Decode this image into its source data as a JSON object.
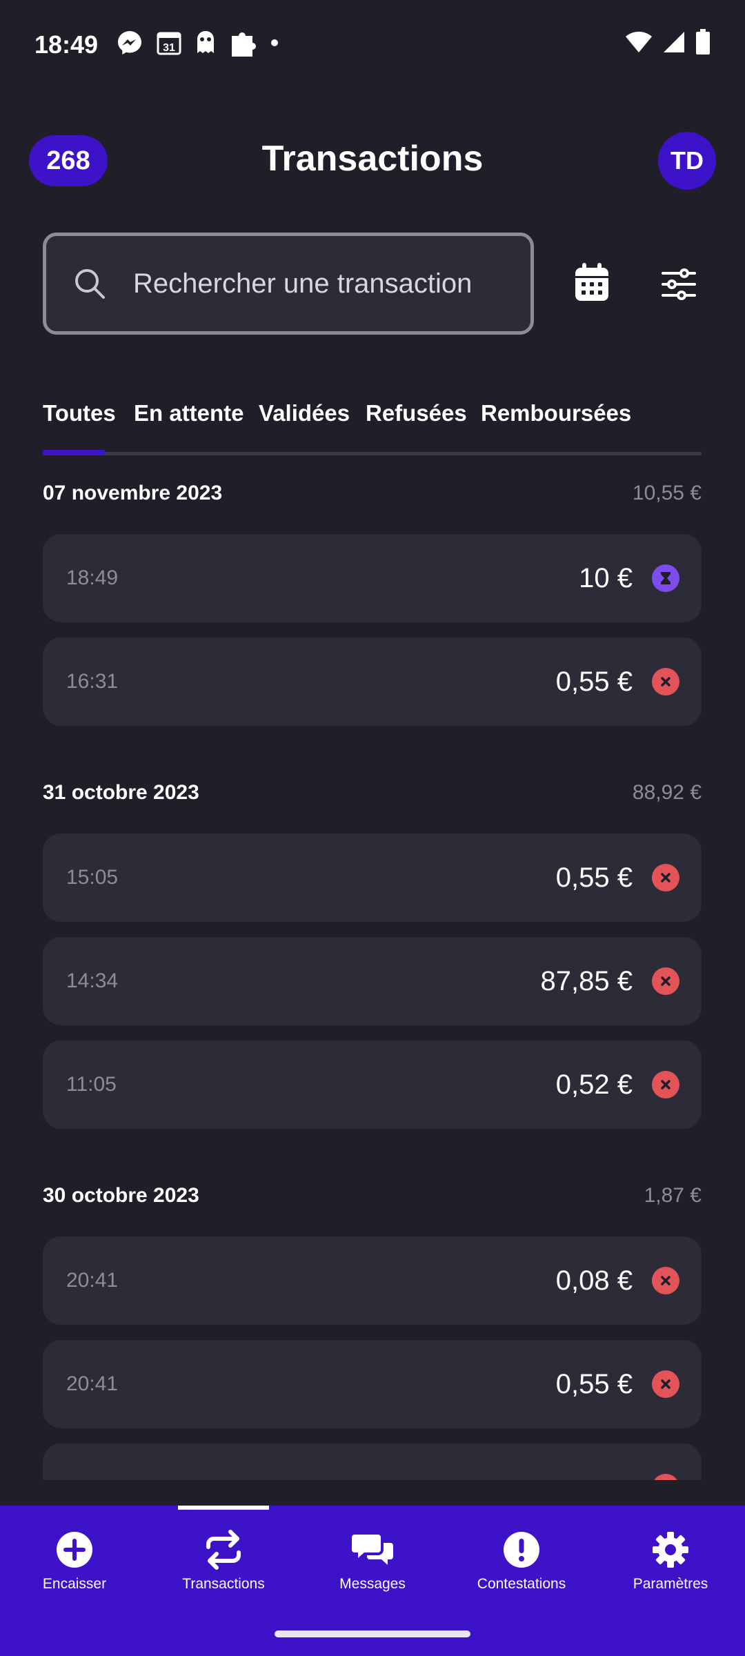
{
  "status_bar": {
    "time": "18:49",
    "left_icons": [
      "messenger-icon",
      "calendar-31-icon",
      "ghost-icon",
      "puzzle-icon",
      "dot-icon"
    ],
    "calendar_day": "31",
    "right_icons": [
      "wifi-icon",
      "signal-icon",
      "battery-icon"
    ]
  },
  "header": {
    "count_badge": "268",
    "title": "Transactions",
    "avatar_initials": "TD"
  },
  "search": {
    "placeholder": "Rechercher une transaction"
  },
  "tabs": [
    {
      "label": "Toutes",
      "active": true
    },
    {
      "label": "En attente",
      "active": false
    },
    {
      "label": "Validées",
      "active": false
    },
    {
      "label": "Refusées",
      "active": false
    },
    {
      "label": "Remboursées",
      "active": false
    }
  ],
  "groups": [
    {
      "date": "07 novembre 2023",
      "total": "10,55 €",
      "transactions": [
        {
          "time": "18:49",
          "amount": "10 €",
          "status": "pending"
        },
        {
          "time": "16:31",
          "amount": "0,55 €",
          "status": "refused"
        }
      ]
    },
    {
      "date": "31 octobre 2023",
      "total": "88,92 €",
      "transactions": [
        {
          "time": "15:05",
          "amount": "0,55 €",
          "status": "refused"
        },
        {
          "time": "14:34",
          "amount": "87,85 €",
          "status": "refused"
        },
        {
          "time": "11:05",
          "amount": "0,52 €",
          "status": "refused"
        }
      ]
    },
    {
      "date": "30 octobre 2023",
      "total": "1,87 €",
      "transactions": [
        {
          "time": "20:41",
          "amount": "0,08 €",
          "status": "refused"
        },
        {
          "time": "20:41",
          "amount": "0,55 €",
          "status": "refused"
        },
        {
          "time": "",
          "amount": "",
          "status": "refused"
        }
      ]
    }
  ],
  "bottom_nav": [
    {
      "label": "Encaisser",
      "icon": "plus-circle-icon",
      "active": false
    },
    {
      "label": "Transactions",
      "icon": "swap-arrows-icon",
      "active": true
    },
    {
      "label": "Messages",
      "icon": "chat-bubbles-icon",
      "active": false
    },
    {
      "label": "Contestations",
      "icon": "exclamation-circle-icon",
      "active": false
    },
    {
      "label": "Paramètres",
      "icon": "gear-icon",
      "active": false
    }
  ],
  "colors": {
    "background": "#1f1e29",
    "card": "#2c2b37",
    "accent": "#3d12c9",
    "refused": "#e35459",
    "pending": "#7c4dec",
    "muted_text": "#8e8d96"
  }
}
